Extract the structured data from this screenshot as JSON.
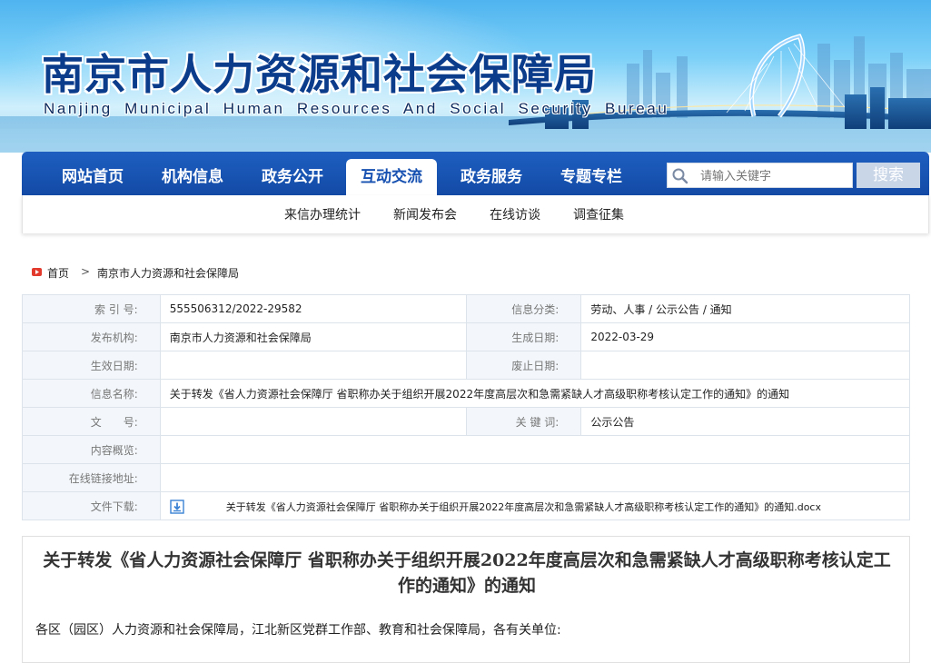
{
  "banner": {
    "title_cn": "南京市人力资源和社会保障局",
    "title_en": "Nanjing Municipal Human Resources And Social Security Bureau"
  },
  "nav": {
    "items": [
      {
        "label": "网站首页",
        "active": false
      },
      {
        "label": "机构信息",
        "active": false
      },
      {
        "label": "政务公开",
        "active": false
      },
      {
        "label": "互动交流",
        "active": true
      },
      {
        "label": "政务服务",
        "active": false
      },
      {
        "label": "专题专栏",
        "active": false
      }
    ],
    "search_placeholder": "请输入关键字",
    "search_button": "搜索"
  },
  "subnav": {
    "items": [
      "来信办理统计",
      "新闻发布会",
      "在线访谈",
      "调查征集"
    ]
  },
  "breadcrumb": {
    "home": "首页",
    "separator": ">",
    "current": "南京市人力资源和社会保障局"
  },
  "info": {
    "index_label": "索 引 号:",
    "index_value": "555506312/2022-29582",
    "category_label": "信息分类:",
    "category_value": "劳动、人事 / 公示公告 / 通知",
    "publisher_label": "发布机构:",
    "publisher_value": "南京市人力资源和社会保障局",
    "created_label": "生成日期:",
    "created_value": "2022-03-29",
    "effective_label": "生效日期:",
    "effective_value": "",
    "expire_label": "废止日期:",
    "expire_value": "",
    "name_label": "信息名称:",
    "name_value": "关于转发《省人力资源社会保障厅 省职称办关于组织开展2022年度高层次和急需紧缺人才高级职称考核认定工作的通知》的通知",
    "docno_label": "文　　号:",
    "docno_value": "",
    "keyword_label": "关 键 词:",
    "keyword_value": "公示公告",
    "overview_label": "内容概览:",
    "overview_value": "",
    "link_label": "在线链接地址:",
    "link_value": "",
    "download_label": "文件下载:",
    "download_value": "关于转发《省人力资源社会保障厅 省职称办关于组织开展2022年度高层次和急需紧缺人才高级职称考核认定工作的通知》的通知.docx"
  },
  "article": {
    "title": "关于转发《省人力资源社会保障厅 省职称办关于组织开展2022年度高层次和急需紧缺人才高级职称考核认定工作的通知》的通知",
    "greeting": "各区（园区）人力资源和社会保障局，江北新区党群工作部、教育和社会保障局，各有关单位:"
  },
  "colors": {
    "nav_blue": "#1650b0",
    "title_blue": "#0b3c8c",
    "label_bg": "#f3f7fb",
    "home_red": "#e23b2e"
  }
}
